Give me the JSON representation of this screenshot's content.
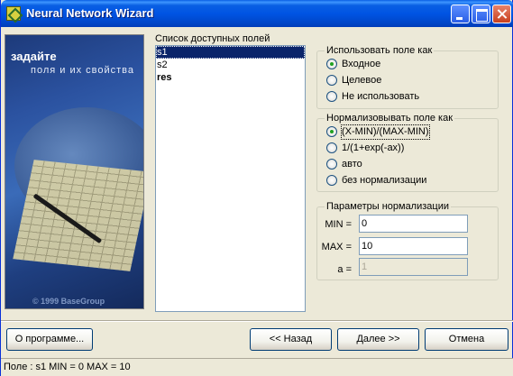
{
  "window": {
    "title": "Neural Network Wizard"
  },
  "side_panel": {
    "heading": "задайте",
    "subheading": "поля и их свойства",
    "copyright": "© 1999 BaseGroup"
  },
  "fields_list": {
    "label": "Список доступных полей",
    "items": [
      "s1",
      "s2",
      "res"
    ]
  },
  "use_as": {
    "title": "Использовать поле как",
    "options": [
      "Входное",
      "Целевое",
      "Не использовать"
    ],
    "selected": "Входное"
  },
  "normalize": {
    "title": "Нормализовывать поле как",
    "options": [
      "(X-MIN)/(MAX-MIN)",
      "1/(1+exp(-ax))",
      "авто",
      "без нормализации"
    ],
    "selected": "(X-MIN)/(MAX-MIN)"
  },
  "params": {
    "title": "Параметры нормализации",
    "min_label": "MIN =",
    "min_value": "0",
    "max_label": "MAX =",
    "max_value": "10",
    "a_label": "a =",
    "a_value": "1"
  },
  "buttons": {
    "about": "О программе...",
    "back": "<< Назад",
    "next": "Далее >>",
    "cancel": "Отмена"
  },
  "status_bar": "Поле : s1  MIN = 0 MAX = 10"
}
